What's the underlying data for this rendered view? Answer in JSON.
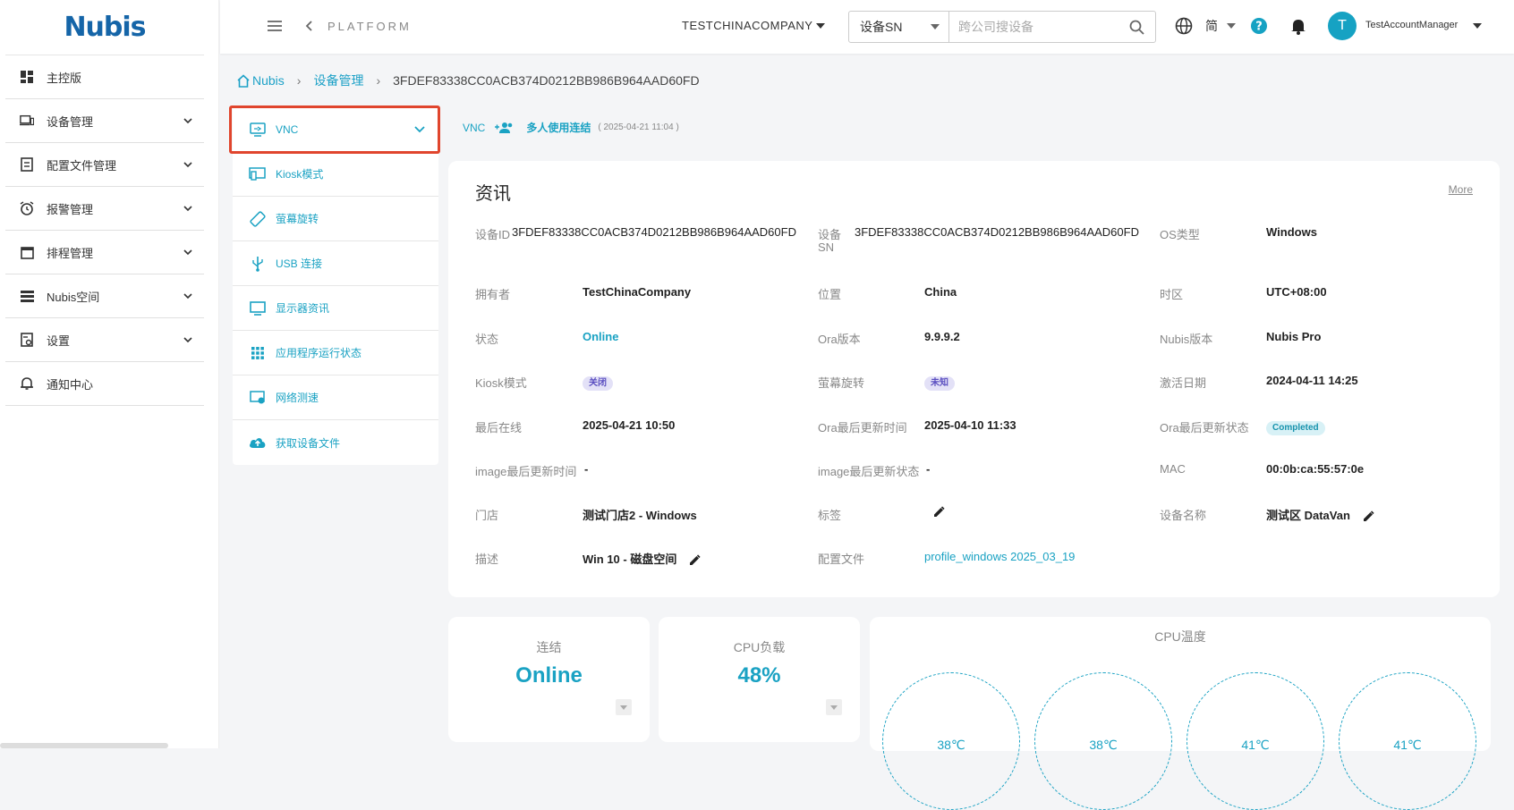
{
  "brand": {
    "logo_text": "Nubis"
  },
  "sidebar": {
    "items": [
      {
        "label": "主控版",
        "icon": "dashboard-icon",
        "expandable": false
      },
      {
        "label": "设备管理",
        "icon": "devices-icon",
        "expandable": true
      },
      {
        "label": "配置文件管理",
        "icon": "config-file-icon",
        "expandable": true
      },
      {
        "label": "报警管理",
        "icon": "alarm-icon",
        "expandable": true
      },
      {
        "label": "排程管理",
        "icon": "calendar-icon",
        "expandable": true
      },
      {
        "label": "Nubis空间",
        "icon": "storage-icon",
        "expandable": true
      },
      {
        "label": "设置",
        "icon": "settings-icon",
        "expandable": true
      },
      {
        "label": "通知中心",
        "icon": "notification-icon",
        "expandable": false
      }
    ]
  },
  "header": {
    "platform": "PLATFORM",
    "company": "TESTCHINACOMPANY",
    "search_type": "设备SN",
    "search_placeholder": "跨公司搜设备",
    "language": "简",
    "avatar_letter": "T",
    "username": "TestAccountManager"
  },
  "breadcrumb": {
    "home": "Nubis",
    "section": "设备管理",
    "current": "3FDEF83338CC0ACB374D0212BB986B964AAD60FD"
  },
  "submenu": {
    "items": [
      {
        "label": "VNC",
        "icon": "vnc-icon"
      },
      {
        "label": "Kiosk模式",
        "icon": "kiosk-icon"
      },
      {
        "label": "萤幕旋转",
        "icon": "screen-rotation-icon"
      },
      {
        "label": "USB 连接",
        "icon": "usb-icon"
      },
      {
        "label": "显示器资讯",
        "icon": "monitor-icon"
      },
      {
        "label": "应用程序运行状态",
        "icon": "apps-grid-icon"
      },
      {
        "label": "网络测速",
        "icon": "network-speed-icon"
      },
      {
        "label": "获取设备文件",
        "icon": "cloud-upload-icon"
      }
    ]
  },
  "vnc_bar": {
    "label": "VNC",
    "multi": "多人使用连结",
    "time": "( 2025-04-21 11:04 )"
  },
  "info": {
    "title": "资讯",
    "more": "More",
    "fields": {
      "device_id": {
        "label": "设备ID",
        "value": "3FDEF83338CC0ACB374D0212BB986B964AAD60FD"
      },
      "device_sn": {
        "label": "设备SN",
        "label_line1": "设备",
        "label_line2": "SN",
        "value": "3FDEF83338CC0ACB374D0212BB986B964AAD60FD"
      },
      "os_type": {
        "label": "OS类型",
        "value": "Windows"
      },
      "owner": {
        "label": "拥有者",
        "value": "TestChinaCompany"
      },
      "location": {
        "label": "位置",
        "value": "China"
      },
      "timezone": {
        "label": "时区",
        "value": "UTC+08:00"
      },
      "status": {
        "label": "状态",
        "value": "Online"
      },
      "ora_version": {
        "label": "Ora版本",
        "value": "9.9.9.2"
      },
      "nubis_version": {
        "label": "Nubis版本",
        "value": "Nubis Pro"
      },
      "kiosk": {
        "label": "Kiosk模式",
        "value": "关闭"
      },
      "rotation": {
        "label": "萤幕旋转",
        "value": "未知"
      },
      "activation": {
        "label": "激活日期",
        "value": "2024-04-11 14:25"
      },
      "last_online": {
        "label": "最后在线",
        "value": "2025-04-21 10:50"
      },
      "ora_updated": {
        "label": "Ora最后更新时间",
        "value": "2025-04-10 11:33"
      },
      "ora_update_status": {
        "label": "Ora最后更新状态",
        "value": "Completed"
      },
      "image_updated": {
        "label": "image最后更新时间",
        "value": "-"
      },
      "image_update_status": {
        "label": "image最后更新状态",
        "value": "-"
      },
      "mac": {
        "label": "MAC",
        "value": "00:0b:ca:55:57:0e"
      },
      "store": {
        "label": "门店",
        "value": "测试门店2 - Windows"
      },
      "tags": {
        "label": "标签",
        "value": ""
      },
      "device_name": {
        "label": "设备名称",
        "value": "测试区 DataVan"
      },
      "description": {
        "label": "描述",
        "value": "Win 10 - 磁盘空间"
      },
      "profile": {
        "label": "配置文件",
        "value": "profile_windows 2025_03_19"
      }
    }
  },
  "stats": {
    "connection": {
      "label": "连结",
      "value": "Online"
    },
    "cpu_load": {
      "label": "CPU负载",
      "value": "48%"
    }
  },
  "cpu_temp": {
    "title": "CPU温度",
    "values": [
      "38℃",
      "38℃",
      "41℃",
      "41℃"
    ]
  },
  "colors": {
    "accent": "#1aa2c3",
    "highlight_border": "#e0452d",
    "brand": "#1565a8"
  }
}
